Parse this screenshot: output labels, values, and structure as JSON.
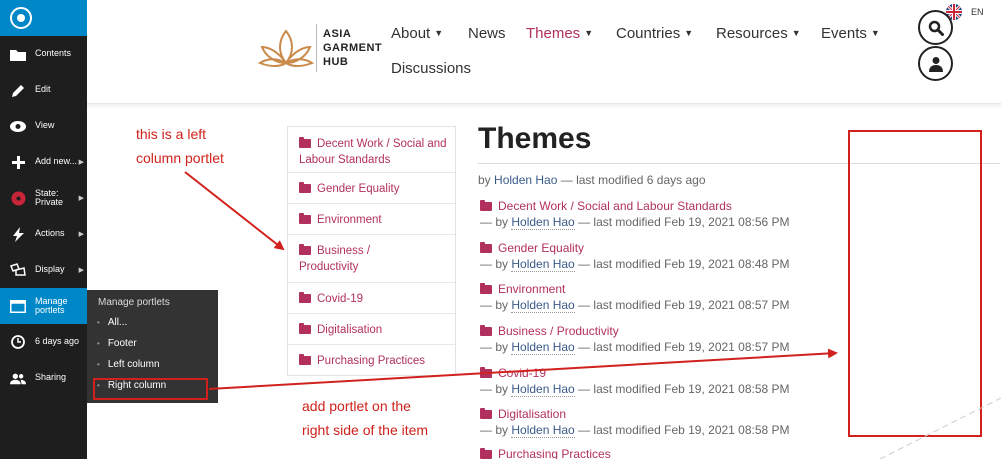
{
  "toolbar": {
    "items": [
      {
        "label": "Contents",
        "icon": "folder-icon"
      },
      {
        "label": "Edit",
        "icon": "pencil-icon"
      },
      {
        "label": "View",
        "icon": "eye-icon"
      },
      {
        "label": "Add new...",
        "icon": "plus-icon"
      },
      {
        "label": "State: Private",
        "icon": "state-icon"
      },
      {
        "label": "Actions",
        "icon": "lightning-icon"
      },
      {
        "label": "Display",
        "icon": "display-icon"
      },
      {
        "label": "Manage portlets",
        "icon": "portlets-icon"
      },
      {
        "label": "6 days ago",
        "icon": "clock-icon"
      },
      {
        "label": "Sharing",
        "icon": "users-icon"
      }
    ],
    "submenu": {
      "title": "Manage portlets",
      "items": [
        "All...",
        "Footer",
        "Left column",
        "Right column"
      ]
    }
  },
  "brand": {
    "line1": "ASIA",
    "line2": "GARMENT",
    "line3": "HUB"
  },
  "nav": {
    "about": "About",
    "news": "News",
    "themes": "Themes",
    "countries": "Countries",
    "resources": "Resources",
    "events": "Events",
    "discussions": "Discussions"
  },
  "language": "EN",
  "portlet": {
    "items": [
      "Decent Work / Social and Labour Standards",
      "Gender Equality",
      "Environment",
      "Business / Productivity",
      "Covid-19",
      "Digitalisation",
      "Purchasing Practices"
    ]
  },
  "page": {
    "title": "Themes",
    "byline_prefix": "by",
    "author": "Holden Hao",
    "byline_suffix": "— last modified 6 days ago"
  },
  "entries": [
    {
      "title": "Decent Work / Social and Labour Standards",
      "meta_prefix": "— by",
      "author": "Holden Hao",
      "modified": "— last modified Feb 19, 2021 08:56 PM"
    },
    {
      "title": "Gender Equality",
      "meta_prefix": "— by",
      "author": "Holden Hao",
      "modified": "— last modified Feb 19, 2021 08:48 PM"
    },
    {
      "title": "Environment",
      "meta_prefix": "— by",
      "author": "Holden Hao",
      "modified": "— last modified Feb 19, 2021 08:57 PM"
    },
    {
      "title": "Business / Productivity",
      "meta_prefix": "— by",
      "author": "Holden Hao",
      "modified": "— last modified Feb 19, 2021 08:57 PM"
    },
    {
      "title": "Covid-19",
      "meta_prefix": "— by",
      "author": "Holden Hao",
      "modified": "— last modified Feb 19, 2021 08:58 PM"
    },
    {
      "title": "Digitalisation",
      "meta_prefix": "— by",
      "author": "Holden Hao",
      "modified": "— last modified Feb 19, 2021 08:58 PM"
    },
    {
      "title": "Purchasing Practices",
      "meta_prefix": "",
      "author": "",
      "modified": ""
    }
  ],
  "annotations": {
    "left_line1": "this is a left",
    "left_line2": "column portlet",
    "right_line1": "add portlet on the",
    "right_line2": "right side of the item"
  },
  "colors": {
    "accent": "#b2305e",
    "toolbar": "#1e1e1e",
    "toolbar_active": "#0087c8",
    "annotation": "#d0211c"
  }
}
